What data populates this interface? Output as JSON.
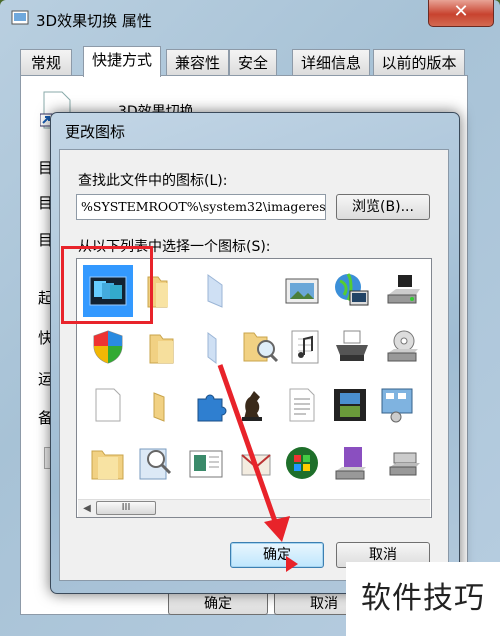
{
  "background_window": {
    "title": "3D效果切换 属性",
    "close_label": "✕",
    "tabs": [
      "常规",
      "快捷方式",
      "兼容性",
      "安全",
      "详细信息",
      "以前的版本"
    ],
    "active_tab": "快捷方式",
    "filename": "3D效果切换",
    "side_labels": [
      "目",
      "目",
      "目",
      "起",
      "快",
      "运",
      "备"
    ],
    "buttons": {
      "ok": "确定",
      "cancel": "取消"
    }
  },
  "dialog": {
    "title": "更改图标",
    "find_label": "查找此文件中的图标(L):",
    "path_value": "%SYSTEMROOT%\\system32\\imageres",
    "browse_label": "浏览(B)...",
    "list_label": "从以下列表中选择一个图标(S):",
    "scrollbar": {
      "left_arrow": "◀",
      "thumb_label": "III"
    },
    "icons": [
      [
        "switch-windows-icon",
        "folder-open-icon",
        "folder-blank-icon",
        "picture-frame-icon",
        "network-globe-icon",
        "drive-icon"
      ],
      [
        "shield-icon",
        "folder-icon",
        "folder-blank-icon",
        "folder-search-icon",
        "music-doc-icon",
        "printer-icon"
      ],
      [
        "document-icon",
        "folder-icon",
        "puzzle-icon",
        "chess-icon",
        "text-doc-icon",
        "film-icon"
      ],
      [
        "folder-icon",
        "magnifier-doc-icon",
        "image-doc-icon",
        "envelope-icon",
        "windows-logo-icon",
        "purple-disc-icon"
      ]
    ],
    "extra_column": [
      "drive-icon",
      "cd-drive-icon",
      "control-panel-icon",
      "usb-drive-icon"
    ],
    "buttons": {
      "ok": "确定",
      "cancel": "取消"
    }
  },
  "colors": {
    "selection": "#3399ff",
    "annotation_red": "#e8232a"
  },
  "watermark": "软件技巧"
}
